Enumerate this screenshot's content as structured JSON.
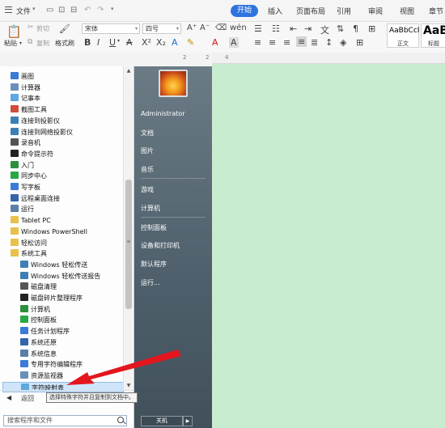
{
  "menubar": {
    "file": "文件",
    "tabs": [
      "开始",
      "插入",
      "页面布局",
      "引用",
      "审阅",
      "视图",
      "章节"
    ]
  },
  "ribbon": {
    "paste": "粘贴",
    "cut": "剪切",
    "copy": "复制",
    "format_painter": "格式刷",
    "font_name": "宋体",
    "font_size": "四号",
    "styles": [
      {
        "preview": "AaBbCcI",
        "name": "正文"
      },
      {
        "preview": "AaB",
        "name": "标题"
      }
    ]
  },
  "ruler": {
    "marks": [
      "2",
      "2",
      "4"
    ]
  },
  "start_menu": {
    "programs": [
      {
        "label": "画图",
        "icon": "paint-icon",
        "indent": 0
      },
      {
        "label": "计算器",
        "icon": "calculator-icon",
        "indent": 0
      },
      {
        "label": "记事本",
        "icon": "notepad-icon",
        "indent": 0
      },
      {
        "label": "截图工具",
        "icon": "snipping-tool-icon",
        "indent": 0
      },
      {
        "label": "连接到投影仪",
        "icon": "projector-icon",
        "indent": 0
      },
      {
        "label": "连接到网络投影仪",
        "icon": "network-projector-icon",
        "indent": 0
      },
      {
        "label": "录音机",
        "icon": "microphone-icon",
        "indent": 0
      },
      {
        "label": "命令提示符",
        "icon": "command-prompt-icon",
        "indent": 0
      },
      {
        "label": "入门",
        "icon": "getting-started-icon",
        "indent": 0
      },
      {
        "label": "同步中心",
        "icon": "sync-center-icon",
        "indent": 0
      },
      {
        "label": "写字板",
        "icon": "wordpad-icon",
        "indent": 0
      },
      {
        "label": "远程桌面连接",
        "icon": "remote-desktop-icon",
        "indent": 0
      },
      {
        "label": "运行",
        "icon": "run-icon",
        "indent": 0
      },
      {
        "label": "Tablet PC",
        "icon": "folder-icon",
        "indent": 0
      },
      {
        "label": "Windows PowerShell",
        "icon": "folder-icon",
        "indent": 0
      },
      {
        "label": "轻松访问",
        "icon": "folder-icon",
        "indent": 0
      },
      {
        "label": "系统工具",
        "icon": "folder-icon",
        "indent": 0
      },
      {
        "label": "Windows 轻松传送",
        "icon": "easy-transfer-icon",
        "indent": 1
      },
      {
        "label": "Windows 轻松传送报告",
        "icon": "easy-transfer-report-icon",
        "indent": 1
      },
      {
        "label": "磁盘清理",
        "icon": "disk-cleanup-icon",
        "indent": 1
      },
      {
        "label": "磁盘碎片整理程序",
        "icon": "defragmenter-icon",
        "indent": 1
      },
      {
        "label": "计算机",
        "icon": "computer-icon",
        "indent": 1
      },
      {
        "label": "控制面板",
        "icon": "control-panel-icon",
        "indent": 1
      },
      {
        "label": "任务计划程序",
        "icon": "task-scheduler-icon",
        "indent": 1
      },
      {
        "label": "系统还原",
        "icon": "system-restore-icon",
        "indent": 1
      },
      {
        "label": "系统信息",
        "icon": "system-info-icon",
        "indent": 1
      },
      {
        "label": "专用字符编辑程序",
        "icon": "private-char-editor-icon",
        "indent": 1
      },
      {
        "label": "资源监视器",
        "icon": "resource-monitor-icon",
        "indent": 1
      },
      {
        "label": "字符映射表",
        "icon": "character-map-icon",
        "indent": 1
      }
    ],
    "back_label": "返回",
    "search_placeholder": "搜索程序和文件",
    "places": [
      "Administrator",
      "文档",
      "图片",
      "音乐",
      "游戏",
      "计算机",
      "控制面板",
      "设备和打印机",
      "默认程序",
      "运行..."
    ],
    "shutdown_label": "关机",
    "tooltip": "选择特殊字符并且复制到文档中。"
  }
}
